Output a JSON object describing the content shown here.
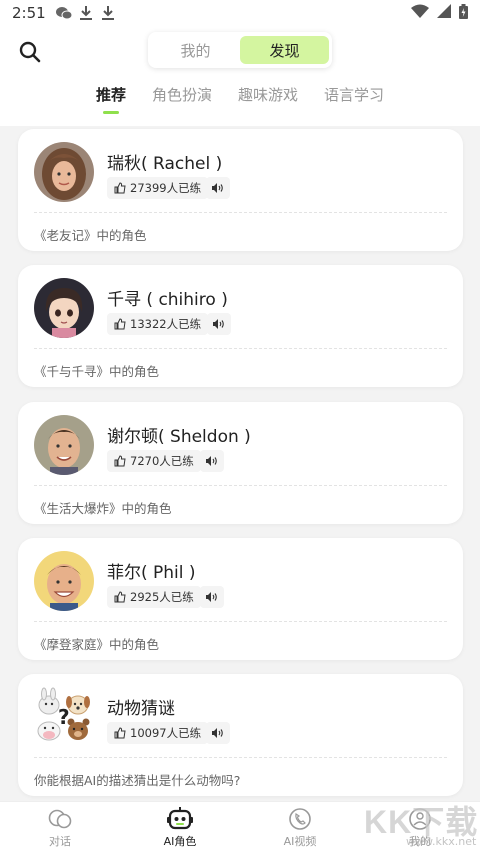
{
  "status_bar": {
    "time": "2:51"
  },
  "header": {
    "segments": [
      {
        "label": "我的",
        "active": false
      },
      {
        "label": "发现",
        "active": true
      }
    ],
    "tabs": [
      {
        "label": "推荐",
        "active": true
      },
      {
        "label": "角色扮演",
        "active": false
      },
      {
        "label": "趣味游戏",
        "active": false
      },
      {
        "label": "语言学习",
        "active": false
      }
    ]
  },
  "cards": [
    {
      "name": "瑞秋( Rachel )",
      "likes": "27399人已练",
      "description": "《老友记》中的角色",
      "avatar_icon": "rachel-avatar"
    },
    {
      "name": "千寻 ( chihiro )",
      "likes": "13322人已练",
      "description": "《千与千寻》中的角色",
      "avatar_icon": "chihiro-avatar"
    },
    {
      "name": "谢尔顿( Sheldon )",
      "likes": "7270人已练",
      "description": "《生活大爆炸》中的角色",
      "avatar_icon": "sheldon-avatar"
    },
    {
      "name": "菲尔( Phil )",
      "likes": "2925人已练",
      "description": "《摩登家庭》中的角色",
      "avatar_icon": "phil-avatar"
    },
    {
      "name": "动物猜谜",
      "likes": "10097人已练",
      "description": "你能根据AI的描述猜出是什么动物吗?",
      "avatar_icon": "animal-emoji-avatar"
    }
  ],
  "bottom_nav": [
    {
      "label": "对话",
      "icon": "chat-icon",
      "active": false
    },
    {
      "label": "AI角色",
      "icon": "robot-icon",
      "active": true
    },
    {
      "label": "AI视频",
      "icon": "video-call-icon",
      "active": false
    },
    {
      "label": "我的",
      "icon": "profile-icon",
      "active": false
    }
  ],
  "watermark": {
    "big": "KK下载",
    "small": "www.kkx.net"
  },
  "colors": {
    "accent": "#8fe04c",
    "segment_active_bg": "#d4f5a0",
    "page_bg": "#f3f3f3"
  }
}
